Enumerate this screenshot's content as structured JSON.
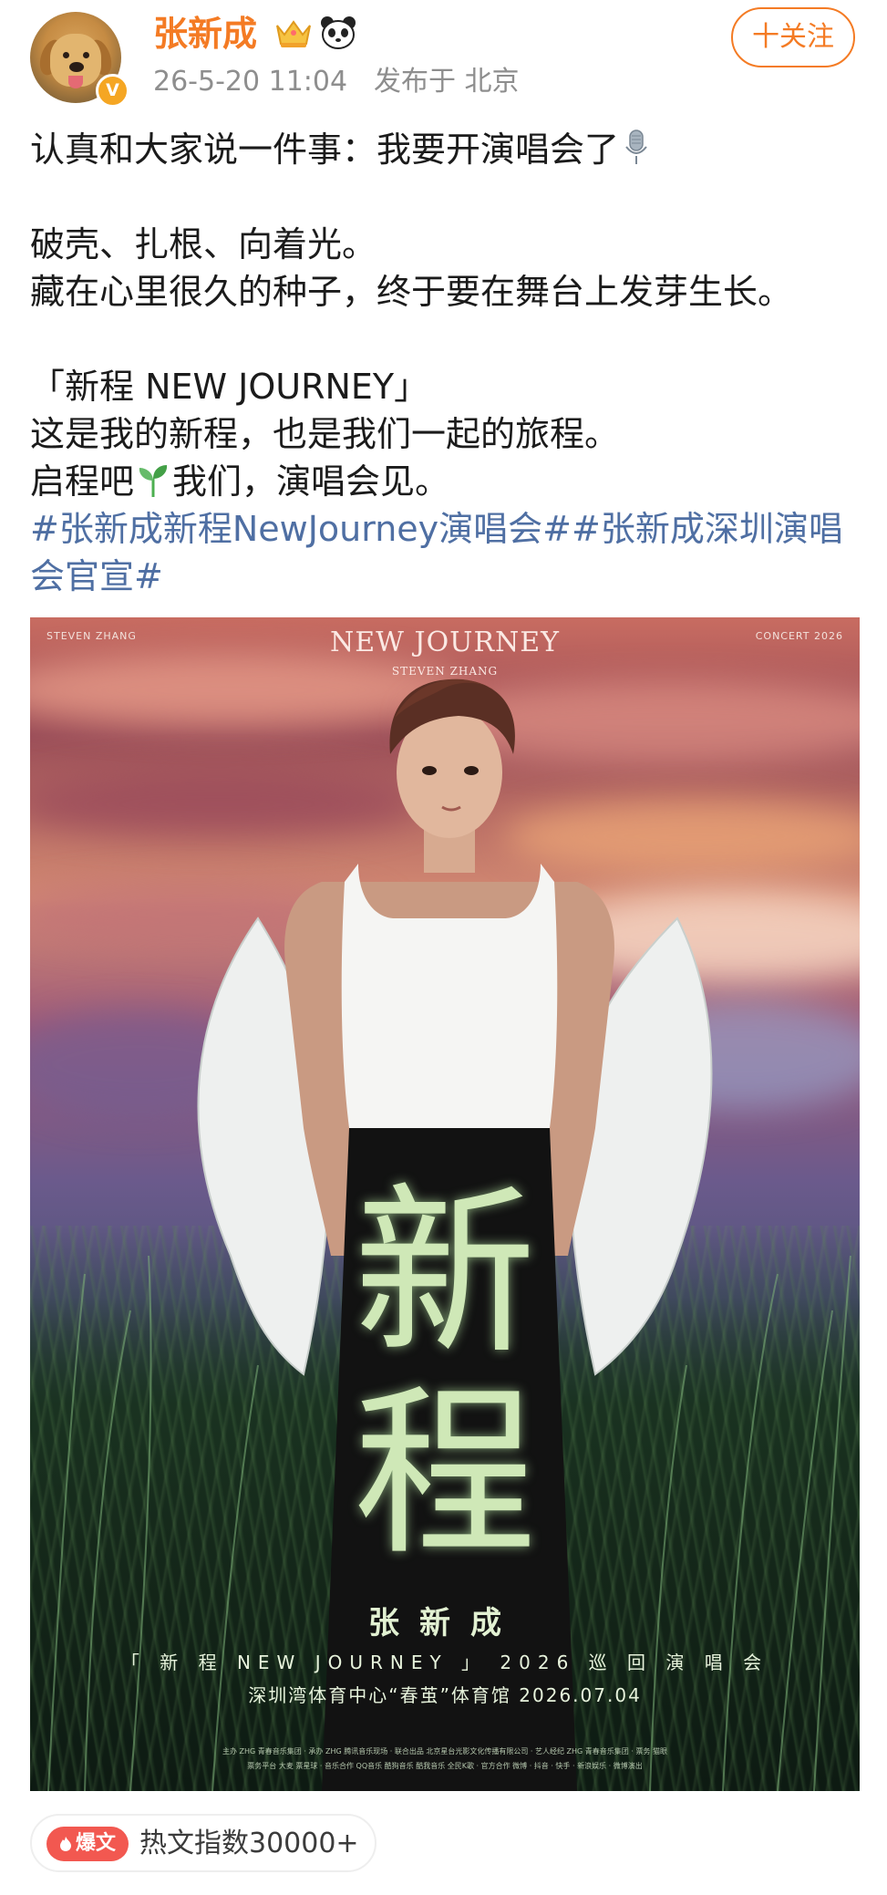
{
  "author": {
    "name": "张新成",
    "verified_badge": "V",
    "timestamp": "26-5-20 11:04",
    "location": "发布于 北京",
    "icons": [
      "crown-icon",
      "panda-icon"
    ],
    "name_color": "#f47b24"
  },
  "follow_button": {
    "label": "十关注"
  },
  "post": {
    "line1": "认真和大家说一件事：我要开演唱会了",
    "line2": "破壳、扎根、向着光。",
    "line3": "藏在心里很久的种子，终于要在舞台上发芽生长。",
    "line4": "「新程 NEW JOURNEY」",
    "line5": "这是我的新程，也是我们一起的旅程。",
    "line6_a": "启程吧",
    "line6_b": "我们，演唱会见。",
    "hashtags": "#张新成新程NewJourney演唱会##张新成深圳演唱会官宣#",
    "hashtag_color": "#4f6fa3"
  },
  "poster": {
    "brand_left": "STEVEN ZHANG",
    "brand_right": "CONCERT 2026",
    "logo": "NEW JOURNEY",
    "logo_sub": "STEVEN ZHANG",
    "big_title": "新程",
    "artist": "张新成",
    "tour_line": "「 新 程 NEW JOURNEY 」 2026 巡 回 演 唱 会",
    "venue_line": "深圳湾体育中心“春茧”体育馆 2026.07.04",
    "sponsors_line1": "主办 ZHG 青春音乐集团 · 承办 ZHG 腾讯音乐现场 · 联合出品 北京星台光影文化传播有限公司 · 艺人经纪 ZHG 青春音乐集团 · 票务 猫眼",
    "sponsors_line2": "票务平台 大麦 票星球 · 音乐合作 QQ音乐 酷狗音乐 酷我音乐 全民K歌 · 官方合作 微博 · 抖音 · 快手 · 新浪娱乐 · 微博演出"
  },
  "hot_badge": {
    "tag": "爆文",
    "text": "热文指数30000+"
  }
}
